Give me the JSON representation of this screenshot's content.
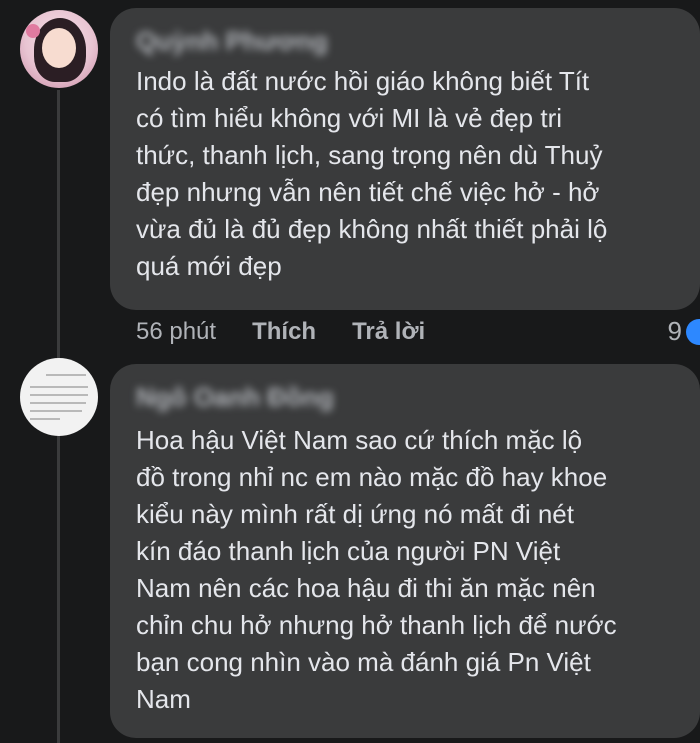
{
  "comments": [
    {
      "author": "Quỳnh Phương",
      "text": "Indo là đất nước hồi giáo không biết Tít\ncó tìm hiểu không với MI là vẻ đẹp tri\nthức, thanh lịch, sang trọng nên dù Thuỷ\nđẹp nhưng vẫn nên tiết chế việc hở - hở\nvừa đủ là đủ đẹp không nhất thiết phải lộ\nquá mới đẹp",
      "time": "56 phút",
      "like_label": "Thích",
      "reply_label": "Trả lời",
      "reaction_count": "9"
    },
    {
      "author": "Ngô Oanh Đồng",
      "text": "Hoa hậu Việt Nam sao cứ thích mặc lộ\nđồ trong nhỉ nc em nào mặc đồ hay khoe\nkiểu này mình rất dị ứng nó mất đi nét\nkín đáo thanh lịch của người PN Việt\nNam nên các hoa hậu đi thi ăn mặc nên\nchỉn chu hở nhưng hở thanh lịch để nước\nbạn cong nhìn vào mà đánh giá Pn Việt\nNam"
    }
  ],
  "colors": {
    "background": "#18191a",
    "bubble": "#3a3b3c",
    "text": "#e4e6eb",
    "muted": "#b0b3b8",
    "reaction": "#2d88ff"
  }
}
